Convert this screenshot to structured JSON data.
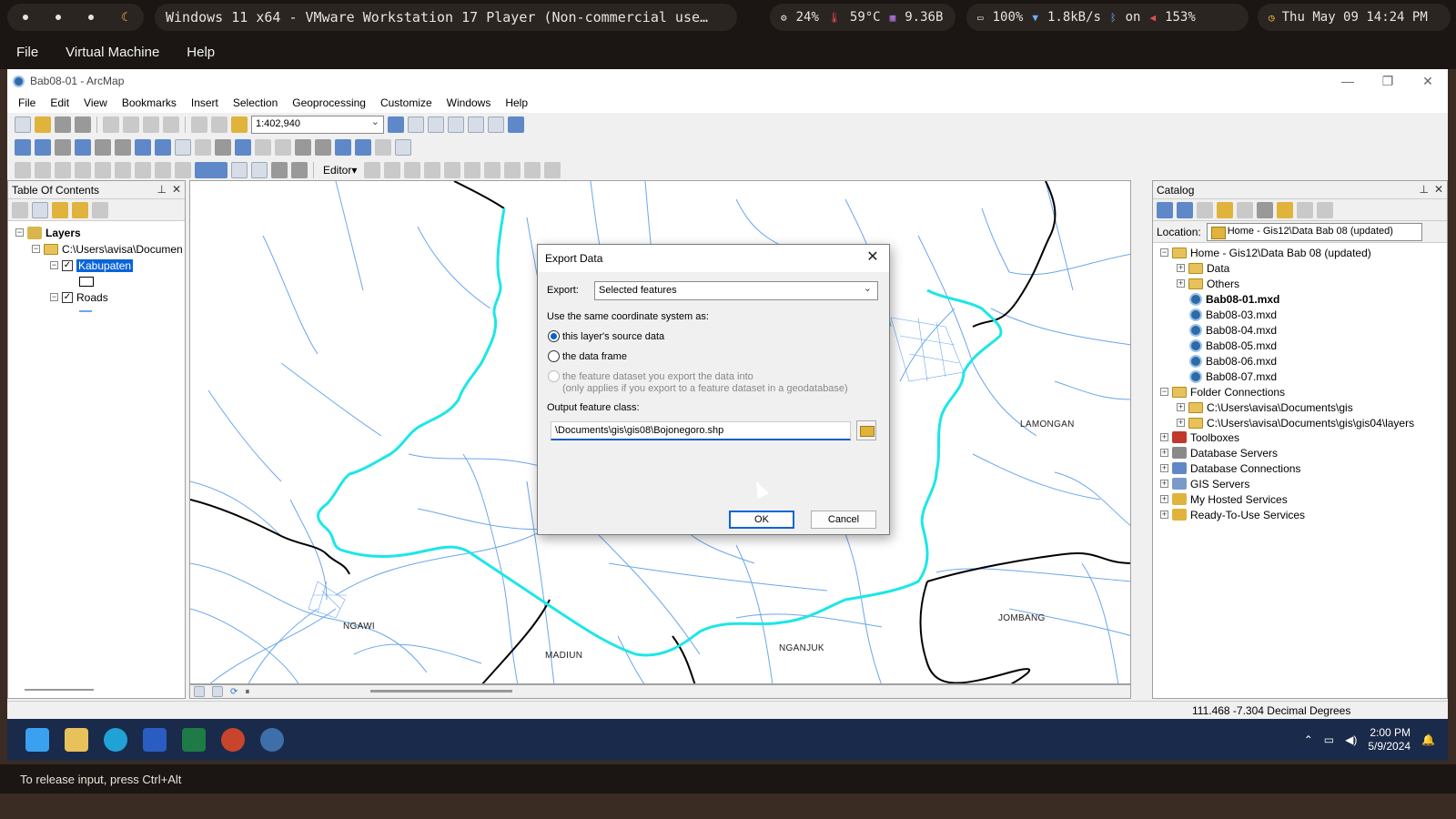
{
  "topbar": {
    "workspaces": [
      "•",
      "•",
      "•"
    ],
    "window_title": "Windows 11 x64 - VMware Workstation 17 Player (Non-commercial use…",
    "cpu": "24%",
    "temp": "59°C",
    "mem": "9.36B",
    "battery": "100%",
    "net_speed": "1.8kB/s",
    "bluetooth": "on",
    "volume": "153%",
    "datetime": "Thu May 09 14:24 PM"
  },
  "vm_menu": [
    "File",
    "Virtual Machine",
    "Help"
  ],
  "arcmap": {
    "title": "Bab08-01 - ArcMap",
    "menu": [
      "File",
      "Edit",
      "View",
      "Bookmarks",
      "Insert",
      "Selection",
      "Geoprocessing",
      "Customize",
      "Windows",
      "Help"
    ],
    "scale": "1:402,940",
    "editor_label": "Editor▾"
  },
  "toc": {
    "title": "Table Of Contents",
    "layers_label": "Layers",
    "folder_path": "C:\\Users\\avisa\\Documen",
    "layer1": "Kabupaten",
    "layer2": "Roads"
  },
  "map_labels": {
    "lamongan": "LAMONGAN",
    "ngawi": "NGAWI",
    "madiun": "MADIUN",
    "nganjuk": "NGANJUK",
    "jombang": "JOMBANG"
  },
  "catalog": {
    "title": "Catalog",
    "location_label": "Location:",
    "location_value": "Home - Gis12\\Data Bab 08 (updated)",
    "home": "Home - Gis12\\Data Bab 08 (updated)",
    "items": [
      "Data",
      "Others"
    ],
    "mxds": [
      "Bab08-01.mxd",
      "Bab08-03.mxd",
      "Bab08-04.mxd",
      "Bab08-05.mxd",
      "Bab08-06.mxd",
      "Bab08-07.mxd"
    ],
    "folder_connections": "Folder Connections",
    "fc_items": [
      "C:\\Users\\avisa\\Documents\\gis",
      "C:\\Users\\avisa\\Documents\\gis\\gis04\\layers"
    ],
    "others": [
      "Toolboxes",
      "Database Servers",
      "Database Connections",
      "GIS Servers",
      "My Hosted Services",
      "Ready-To-Use Services"
    ]
  },
  "status": {
    "coords": "111.468  -7.304 Decimal Degrees"
  },
  "dialog": {
    "title": "Export Data",
    "export_label": "Export:",
    "export_value": "Selected features",
    "coord_label": "Use the same coordinate system as:",
    "opt1": "this layer's source data",
    "opt2": "the data frame",
    "opt3a": "the feature dataset you export the data into",
    "opt3b": "(only applies if you export to a feature dataset in a geodatabase)",
    "output_label": "Output feature class:",
    "output_value": "\\Documents\\gis\\gis08\\Bojonegoro.shp",
    "ok": "OK",
    "cancel": "Cancel"
  },
  "taskbar": {
    "time": "2:00 PM",
    "date": "5/9/2024"
  },
  "vm_status": "To release input, press Ctrl+Alt",
  "colors": {
    "boundary_highlight": "#1ee6e6",
    "roads": "#6aa6ee",
    "accent": "#0a64d8"
  }
}
